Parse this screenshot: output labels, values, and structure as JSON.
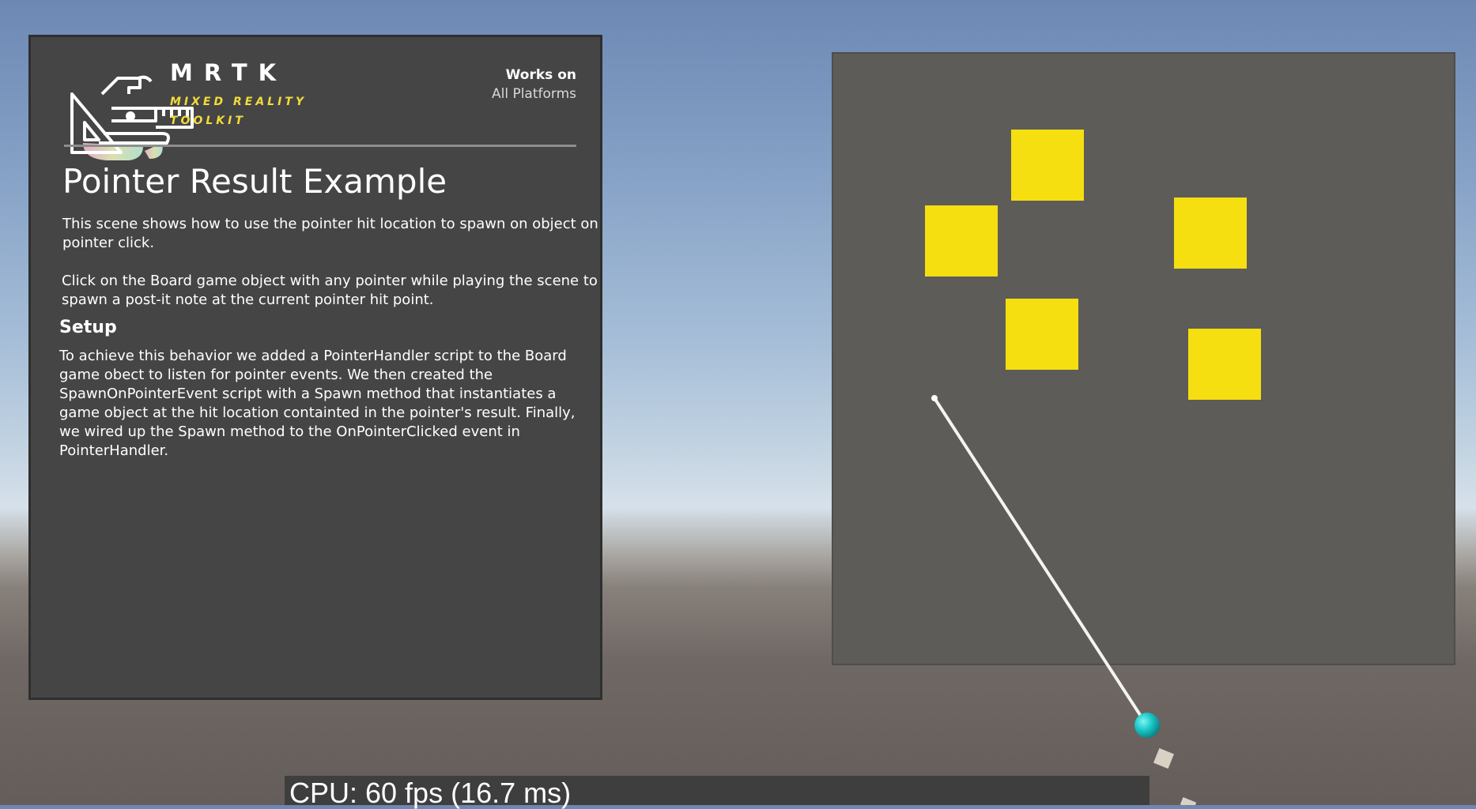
{
  "brand": {
    "name": "MRTK",
    "subtitle": "MIXED REALITY TOOLKIT",
    "logo_icon": "mrtk-logo-icon"
  },
  "works_on": {
    "title": "Works on",
    "value": "All Platforms"
  },
  "panel": {
    "title": "Pointer Result Example",
    "paragraph1": "This scene shows how to use the pointer hit location to spawn on object on pointer click.",
    "paragraph2": "Click on the Board game object with any pointer while playing the scene to spawn a post-it note at the current pointer hit point.",
    "setup_heading": "Setup",
    "setup_text": "To achieve this behavior we added a PointerHandler script to the Board game obect to listen for pointer events. We then created the SpawnOnPointerEvent script with a Spawn method that instantiates a game object at the hit location containted in the pointer's result. Finally, we wired up the Spawn method to the OnPointerClicked event in PointerHandler."
  },
  "board": {
    "post_it_count": 5,
    "post_it_color": "#f5df10",
    "board_color": "#5d5c58"
  },
  "pointer": {
    "ray_icon": "pointer-ray",
    "cursor_color": "#19c7c7"
  },
  "stats": {
    "cpu": "CPU: 60 fps (16.7 ms)"
  },
  "colors": {
    "panel_background": "#454545",
    "accent_yellow": "#f2dc3a"
  }
}
